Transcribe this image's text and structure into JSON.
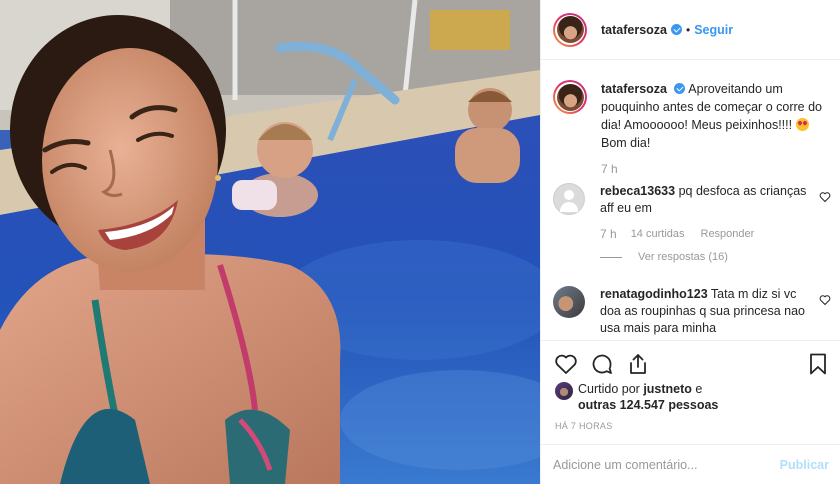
{
  "post": {
    "image_alt": "Selfie of a smiling woman in a blue pool with two babies swimming behind her"
  },
  "header": {
    "username": "tatafersoza",
    "separator": "•",
    "follow_label": "Seguir"
  },
  "caption": {
    "username": "tatafersoza",
    "text": "Aproveitando um pouquinho antes de começar o corre do dia! Amoooooo! Meus peixinhos!!!! ",
    "text_end": " Bom dia!",
    "time": "7 h"
  },
  "comments": [
    {
      "username": "rebeca13633",
      "text": "pq desfoca as crianças aff eu em",
      "time": "7 h",
      "likes": "14 curtidas",
      "reply_label": "Responder",
      "view_replies": "Ver respostas (16)"
    },
    {
      "username": "renatagodinho123",
      "text": "Tata m diz si vc doa as roupinhas q sua princesa nao usa mais para minha"
    }
  ],
  "actions": {
    "liked_prefix": "Curtido por ",
    "liked_user": "justneto",
    "liked_mid": " e",
    "liked_others": "outras 124.547 pessoas",
    "time_ago": "HÁ 7 HORAS"
  },
  "add_comment": {
    "placeholder": "Adicione um comentário...",
    "publish_label": "Publicar"
  },
  "colors": {
    "link_blue": "#3897f0",
    "publish_disabled": "#b2dffc",
    "verified_blue": "#3897f0"
  }
}
